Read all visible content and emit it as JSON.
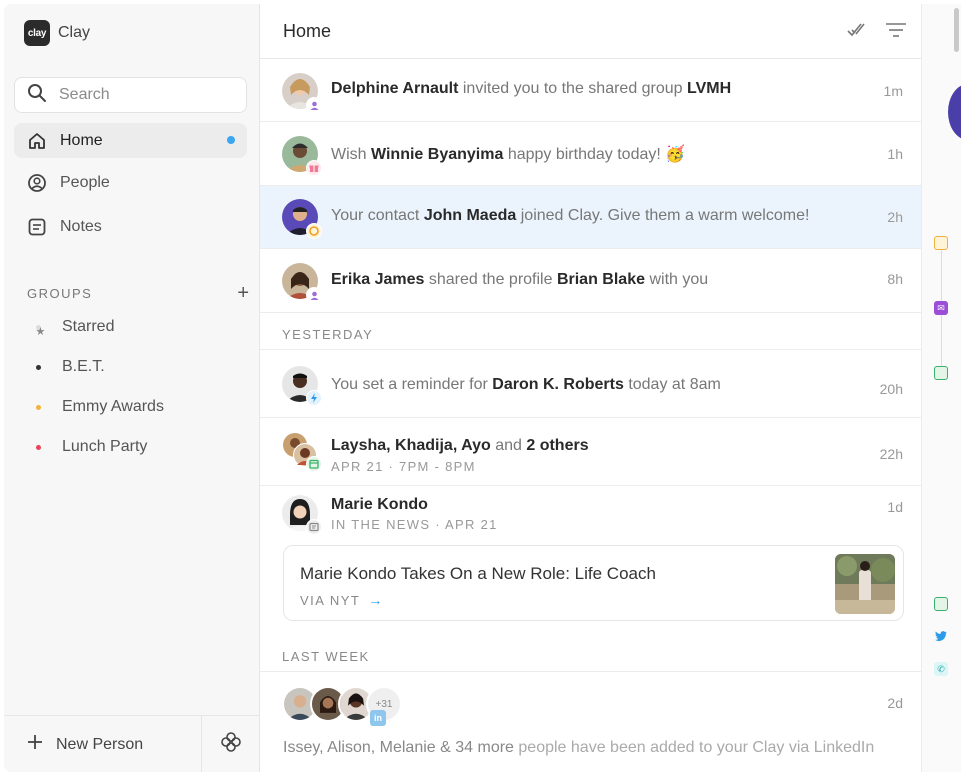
{
  "sidebar": {
    "brand": {
      "logo": "clay",
      "name": "Clay"
    },
    "search": {
      "placeholder": "Search"
    },
    "nav": [
      {
        "label": "Home",
        "icon": "home-icon",
        "active": true,
        "has_unread": true
      },
      {
        "label": "People",
        "icon": "person-icon"
      },
      {
        "label": "Notes",
        "icon": "notes-icon"
      }
    ],
    "groups_title": "GROUPS",
    "groups": [
      {
        "label": "Starred",
        "icon": "star-icon"
      },
      {
        "label": "B.E.T.",
        "color": "#333333"
      },
      {
        "label": "Emmy Awards",
        "color": "#f5b23a"
      },
      {
        "label": "Lunch Party",
        "color": "#e8455b"
      }
    ],
    "new_person_label": "New Person"
  },
  "main": {
    "title": "Home",
    "feed": [
      {
        "actor": "Delphine Arnault",
        "text_mid": "invited you to the shared group",
        "target": "LVMH",
        "time": "1m",
        "badge": "group-icon"
      },
      {
        "prefix": "Wish",
        "actor": "Winnie Byanyima",
        "text_mid": "happy birthday today!",
        "emoji": "🥳",
        "time": "1h",
        "badge": "gift-icon"
      },
      {
        "prefix": "Your contact",
        "actor": "John Maeda",
        "text_mid": "joined Clay. Give them a warm welcome!",
        "time": "2h",
        "badge": "clay-icon",
        "highlight": true
      },
      {
        "actor": "Erika James",
        "text_mid": "shared the profile",
        "target": "Brian Blake",
        "text_end": "with you",
        "time": "8h",
        "badge": "group-icon"
      }
    ],
    "yesterday_label": "YESTERDAY",
    "yesterday": [
      {
        "prefix": "You set a reminder for",
        "actor": "Daron K. Roberts",
        "text_end": "today at 8am",
        "time": "20h",
        "badge": "bolt-icon"
      },
      {
        "actor": "Laysha, Khadija, Ayo",
        "text_mid": "and",
        "target": "2 others",
        "sub": "APR 21 · 7PM - 8PM",
        "time": "22h",
        "badge": "calendar-icon"
      },
      {
        "actor": "Marie Kondo",
        "sub": "IN THE NEWS · APR 21",
        "time": "1d",
        "badge": "news-icon"
      }
    ],
    "news_card": {
      "title": "Marie Kondo Takes On a New Role: Life Coach",
      "via": "VIA NYT",
      "arrow": "→"
    },
    "last_week_label": "LAST WEEK",
    "last_week": {
      "more_count": "+31",
      "time": "2d",
      "names": "Issey, Alison, Melanie",
      "and": "&",
      "more": "34 more",
      "text": "people have been added to your Clay via",
      "source": "LinkedIn"
    }
  },
  "rail": {
    "icons": [
      "note-icon",
      "mail-icon",
      "calendar-icon",
      "calendar-icon",
      "twitter-icon",
      "phone-icon"
    ]
  }
}
